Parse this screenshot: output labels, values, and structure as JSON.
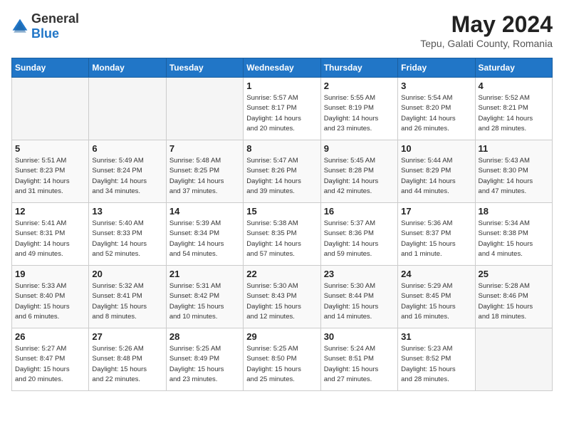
{
  "app": {
    "name_general": "General",
    "name_blue": "Blue"
  },
  "title": {
    "month_year": "May 2024",
    "location": "Tepu, Galati County, Romania"
  },
  "days_header": [
    "Sunday",
    "Monday",
    "Tuesday",
    "Wednesday",
    "Thursday",
    "Friday",
    "Saturday"
  ],
  "weeks": [
    [
      {
        "day": "",
        "info": ""
      },
      {
        "day": "",
        "info": ""
      },
      {
        "day": "",
        "info": ""
      },
      {
        "day": "1",
        "info": "Sunrise: 5:57 AM\nSunset: 8:17 PM\nDaylight: 14 hours\nand 20 minutes."
      },
      {
        "day": "2",
        "info": "Sunrise: 5:55 AM\nSunset: 8:19 PM\nDaylight: 14 hours\nand 23 minutes."
      },
      {
        "day": "3",
        "info": "Sunrise: 5:54 AM\nSunset: 8:20 PM\nDaylight: 14 hours\nand 26 minutes."
      },
      {
        "day": "4",
        "info": "Sunrise: 5:52 AM\nSunset: 8:21 PM\nDaylight: 14 hours\nand 28 minutes."
      }
    ],
    [
      {
        "day": "5",
        "info": "Sunrise: 5:51 AM\nSunset: 8:23 PM\nDaylight: 14 hours\nand 31 minutes."
      },
      {
        "day": "6",
        "info": "Sunrise: 5:49 AM\nSunset: 8:24 PM\nDaylight: 14 hours\nand 34 minutes."
      },
      {
        "day": "7",
        "info": "Sunrise: 5:48 AM\nSunset: 8:25 PM\nDaylight: 14 hours\nand 37 minutes."
      },
      {
        "day": "8",
        "info": "Sunrise: 5:47 AM\nSunset: 8:26 PM\nDaylight: 14 hours\nand 39 minutes."
      },
      {
        "day": "9",
        "info": "Sunrise: 5:45 AM\nSunset: 8:28 PM\nDaylight: 14 hours\nand 42 minutes."
      },
      {
        "day": "10",
        "info": "Sunrise: 5:44 AM\nSunset: 8:29 PM\nDaylight: 14 hours\nand 44 minutes."
      },
      {
        "day": "11",
        "info": "Sunrise: 5:43 AM\nSunset: 8:30 PM\nDaylight: 14 hours\nand 47 minutes."
      }
    ],
    [
      {
        "day": "12",
        "info": "Sunrise: 5:41 AM\nSunset: 8:31 PM\nDaylight: 14 hours\nand 49 minutes."
      },
      {
        "day": "13",
        "info": "Sunrise: 5:40 AM\nSunset: 8:33 PM\nDaylight: 14 hours\nand 52 minutes."
      },
      {
        "day": "14",
        "info": "Sunrise: 5:39 AM\nSunset: 8:34 PM\nDaylight: 14 hours\nand 54 minutes."
      },
      {
        "day": "15",
        "info": "Sunrise: 5:38 AM\nSunset: 8:35 PM\nDaylight: 14 hours\nand 57 minutes."
      },
      {
        "day": "16",
        "info": "Sunrise: 5:37 AM\nSunset: 8:36 PM\nDaylight: 14 hours\nand 59 minutes."
      },
      {
        "day": "17",
        "info": "Sunrise: 5:36 AM\nSunset: 8:37 PM\nDaylight: 15 hours\nand 1 minute."
      },
      {
        "day": "18",
        "info": "Sunrise: 5:34 AM\nSunset: 8:38 PM\nDaylight: 15 hours\nand 4 minutes."
      }
    ],
    [
      {
        "day": "19",
        "info": "Sunrise: 5:33 AM\nSunset: 8:40 PM\nDaylight: 15 hours\nand 6 minutes."
      },
      {
        "day": "20",
        "info": "Sunrise: 5:32 AM\nSunset: 8:41 PM\nDaylight: 15 hours\nand 8 minutes."
      },
      {
        "day": "21",
        "info": "Sunrise: 5:31 AM\nSunset: 8:42 PM\nDaylight: 15 hours\nand 10 minutes."
      },
      {
        "day": "22",
        "info": "Sunrise: 5:30 AM\nSunset: 8:43 PM\nDaylight: 15 hours\nand 12 minutes."
      },
      {
        "day": "23",
        "info": "Sunrise: 5:30 AM\nSunset: 8:44 PM\nDaylight: 15 hours\nand 14 minutes."
      },
      {
        "day": "24",
        "info": "Sunrise: 5:29 AM\nSunset: 8:45 PM\nDaylight: 15 hours\nand 16 minutes."
      },
      {
        "day": "25",
        "info": "Sunrise: 5:28 AM\nSunset: 8:46 PM\nDaylight: 15 hours\nand 18 minutes."
      }
    ],
    [
      {
        "day": "26",
        "info": "Sunrise: 5:27 AM\nSunset: 8:47 PM\nDaylight: 15 hours\nand 20 minutes."
      },
      {
        "day": "27",
        "info": "Sunrise: 5:26 AM\nSunset: 8:48 PM\nDaylight: 15 hours\nand 22 minutes."
      },
      {
        "day": "28",
        "info": "Sunrise: 5:25 AM\nSunset: 8:49 PM\nDaylight: 15 hours\nand 23 minutes."
      },
      {
        "day": "29",
        "info": "Sunrise: 5:25 AM\nSunset: 8:50 PM\nDaylight: 15 hours\nand 25 minutes."
      },
      {
        "day": "30",
        "info": "Sunrise: 5:24 AM\nSunset: 8:51 PM\nDaylight: 15 hours\nand 27 minutes."
      },
      {
        "day": "31",
        "info": "Sunrise: 5:23 AM\nSunset: 8:52 PM\nDaylight: 15 hours\nand 28 minutes."
      },
      {
        "day": "",
        "info": ""
      }
    ]
  ]
}
